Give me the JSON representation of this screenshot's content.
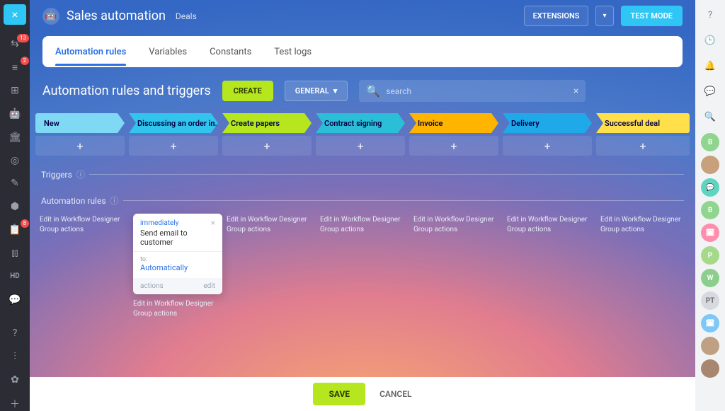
{
  "left_sidebar": {
    "close": "×",
    "badges": {
      "activity": "13",
      "crm": "2",
      "tasks": "8"
    },
    "hd_label": "HD"
  },
  "header": {
    "title": "Sales automation",
    "subtitle": "Deals",
    "extensions_label": "EXTENSIONS",
    "test_mode_label": "TEST MODE"
  },
  "tabs": [
    {
      "label": "Automation rules",
      "active": true
    },
    {
      "label": "Variables"
    },
    {
      "label": "Constants"
    },
    {
      "label": "Test logs"
    }
  ],
  "page_title": "Automation rules and triggers",
  "buttons": {
    "create_label": "CREATE",
    "general_label": "GENERAL",
    "save_label": "SAVE",
    "cancel_label": "CANCEL"
  },
  "search": {
    "placeholder": "search"
  },
  "stages": [
    {
      "label": "New",
      "color": "#7fd9f5"
    },
    {
      "label": "Discussing an order in...",
      "color": "#31c4ec"
    },
    {
      "label": "Create papers",
      "color": "#b6e61e"
    },
    {
      "label": "Contract signing",
      "color": "#2bbed7"
    },
    {
      "label": "Invoice",
      "color": "#ffb400"
    },
    {
      "label": "Delivery",
      "color": "#1fa9e8"
    },
    {
      "label": "Successful deal",
      "color": "#ffe04a"
    }
  ],
  "sections": {
    "triggers": "Triggers",
    "automation_rules": "Automation rules"
  },
  "col_links": {
    "edit": "Edit in Workflow Designer",
    "group": "Group actions"
  },
  "card": {
    "immediately": "immediately",
    "close": "×",
    "title": "Send email to customer",
    "sub_label": "to:",
    "value": "Automatically",
    "foot_left": "actions",
    "foot_right": "edit"
  },
  "right_sidebar_avatars": [
    {
      "text": "B",
      "bg": "#8fd48f"
    },
    {
      "text": "",
      "bg": "#c9a07c",
      "img": true
    },
    {
      "text": "",
      "bg": "#5dd6c1",
      "icon": "chat"
    },
    {
      "text": "B",
      "bg": "#8fd48f"
    },
    {
      "text": "",
      "bg": "#ff8eae",
      "icon": "cal"
    },
    {
      "text": "P",
      "bg": "#a6d98a"
    },
    {
      "text": "W",
      "bg": "#8ccf8c"
    },
    {
      "text": "PT",
      "bg": "#d6d9df",
      "dark": true
    },
    {
      "text": "",
      "bg": "#7ec8f7",
      "icon": "cal"
    },
    {
      "text": "",
      "bg": "#bfa083",
      "img": true
    },
    {
      "text": "",
      "bg": "#a8866f",
      "img": true
    }
  ]
}
